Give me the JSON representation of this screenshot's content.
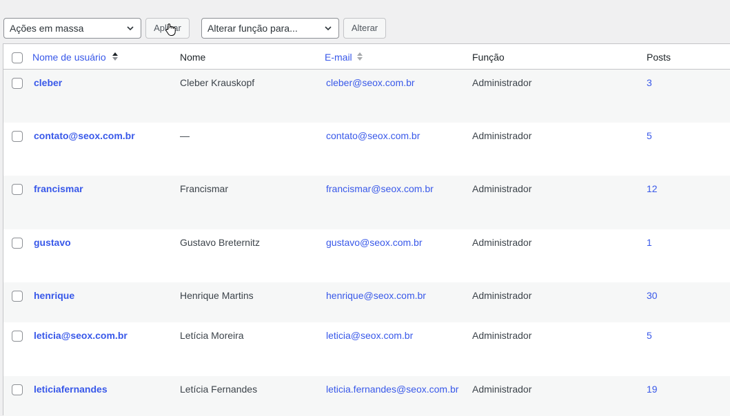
{
  "toolbar": {
    "bulk_actions_value": "Ações em massa",
    "apply_label": "Aplicar",
    "change_role_value": "Alterar função para...",
    "change_label": "Alterar"
  },
  "table": {
    "headers": {
      "username": "Nome de usuário",
      "name": "Nome",
      "email": "E-mail",
      "role": "Função",
      "posts": "Posts"
    },
    "rows": [
      {
        "username": "cleber",
        "name": "Cleber Krauskopf",
        "email": "cleber@seox.com.br",
        "role": "Administrador",
        "posts": "3"
      },
      {
        "username": "contato@seox.com.br",
        "name": "—",
        "email": "contato@seox.com.br",
        "role": "Administrador",
        "posts": "5"
      },
      {
        "username": "francismar",
        "name": "Francismar",
        "email": "francismar@seox.com.br",
        "role": "Administrador",
        "posts": "12"
      },
      {
        "username": "gustavo",
        "name": "Gustavo Breternitz",
        "email": "gustavo@seox.com.br",
        "role": "Administrador",
        "posts": "1"
      },
      {
        "username": "henrique",
        "name": "Henrique Martins",
        "email": "henrique@seox.com.br",
        "role": "Administrador",
        "posts": "30"
      },
      {
        "username": "leticia@seox.com.br",
        "name": "Letícia Moreira",
        "email": "leticia@seox.com.br",
        "role": "Administrador",
        "posts": "5"
      },
      {
        "username": "leticiafernandes",
        "name": "Letícia Fernandes",
        "email": "leticia.fernandes@seox.com.br",
        "role": "Administrador",
        "posts": "19"
      }
    ]
  },
  "colors": {
    "link": "#3858e9",
    "alt_row": "#f6f7f7",
    "page_bg": "#f0f0f1"
  },
  "icons": [
    "chevron-down-icon",
    "sort-indicator-icon",
    "hand-pointer-icon"
  ]
}
